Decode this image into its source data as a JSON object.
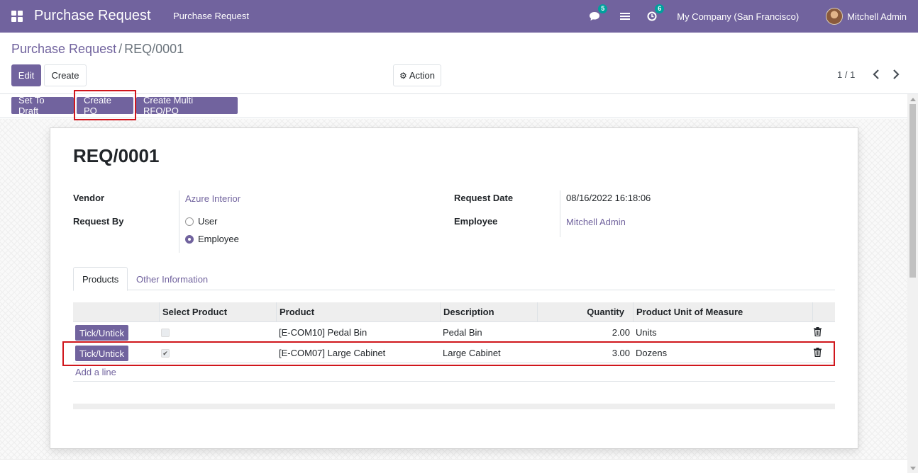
{
  "navbar": {
    "app_title": "Purchase Request",
    "menu_item": "Purchase Request",
    "messages_count": "5",
    "activities_count": "6",
    "company": "My Company (San Francisco)",
    "user_name": "Mitchell Admin"
  },
  "breadcrumb": {
    "parent": "Purchase Request",
    "separator": "/",
    "current": "REQ/0001"
  },
  "control_panel": {
    "edit_label": "Edit",
    "create_label": "Create",
    "action_label": "Action",
    "pager": "1 / 1"
  },
  "statusbar": {
    "set_to_draft": "Set To Draft",
    "create_po": "Create PO",
    "create_multi": "Create Multi RFQ/PO"
  },
  "form": {
    "title": "REQ/0001",
    "vendor_label": "Vendor",
    "vendor_value": "Azure Interior",
    "request_by_label": "Request By",
    "request_by_options": [
      "User",
      "Employee"
    ],
    "request_by_selected": "Employee",
    "request_date_label": "Request Date",
    "request_date_value": "08/16/2022 16:18:06",
    "employee_label": "Employee",
    "employee_value": "Mitchell Admin"
  },
  "tabs": {
    "products": "Products",
    "other": "Other Information"
  },
  "table": {
    "headers": {
      "select": "Select Product",
      "product": "Product",
      "description": "Description",
      "quantity": "Quantity",
      "uom": "Product Unit of Measure"
    },
    "tick_label": "Tick/Untick",
    "rows": [
      {
        "selected": false,
        "product": "[E-COM10] Pedal Bin",
        "description": "Pedal Bin",
        "quantity": "2.00",
        "uom": "Units"
      },
      {
        "selected": true,
        "product": "[E-COM07] Large Cabinet",
        "description": "Large Cabinet",
        "quantity": "3.00",
        "uom": "Dozens"
      }
    ],
    "add_line": "Add a line"
  },
  "colors": {
    "brand": "#71639e",
    "highlight": "#d0161c",
    "badge": "#00a09d"
  }
}
